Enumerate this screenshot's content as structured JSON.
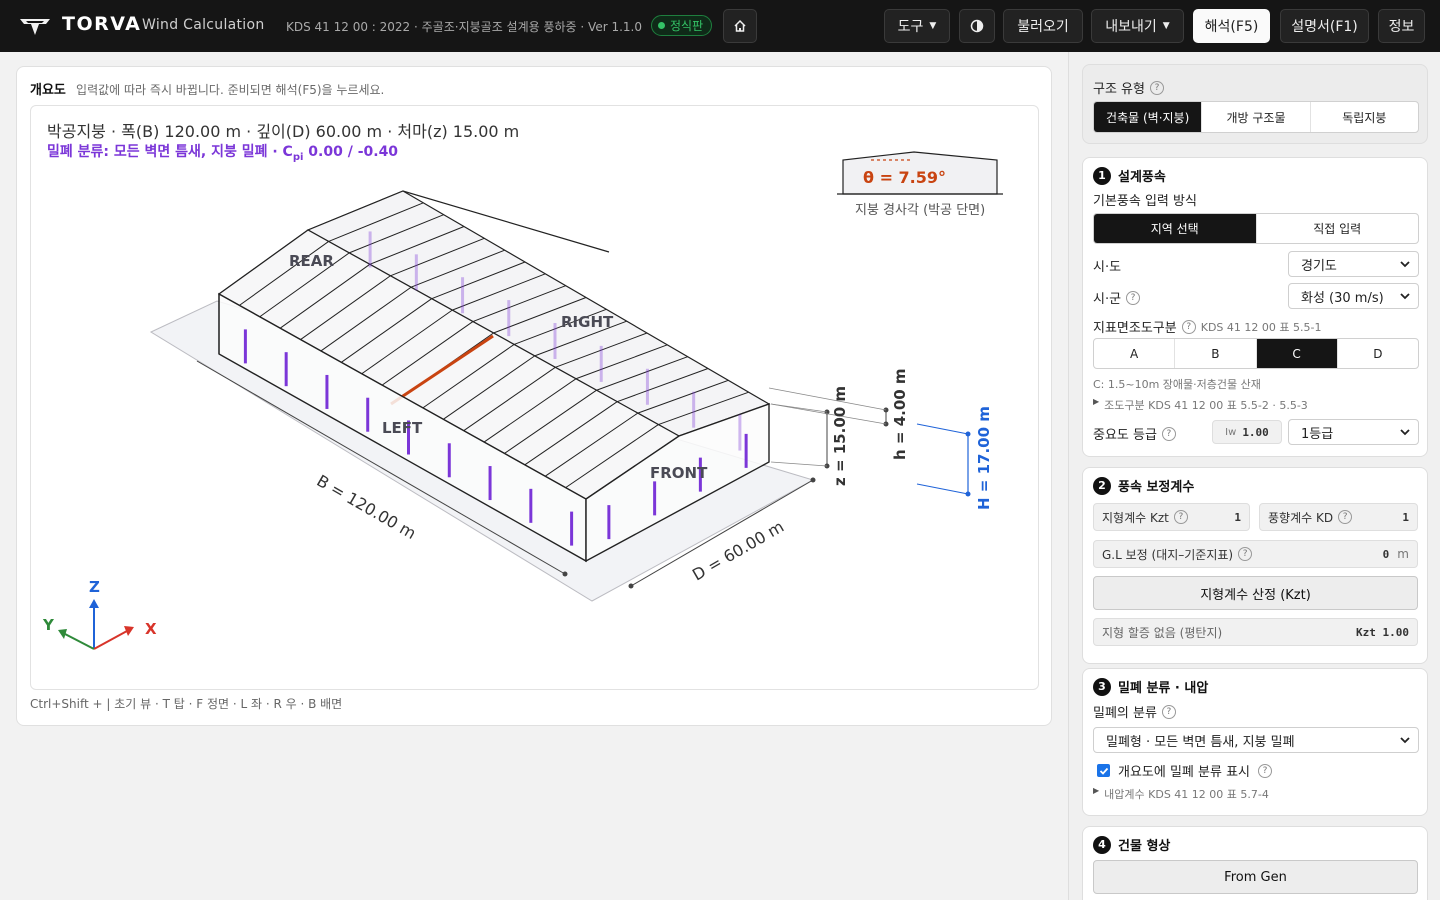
{
  "app": {
    "brand": "TORVA",
    "subtitle": "Wind Calculation",
    "standard": "KDS 41 12 00 : 2022 · 주골조·지붕골조 설계용 풍하중 · Ver 1.1.0",
    "badge": "정식판"
  },
  "toolbar": {
    "tools_label": "도구",
    "load_label": "불러오기",
    "export_label": "내보내기",
    "analyze_label": "해석(F5)",
    "report_label": "설명서(F1)",
    "info_label": "정보"
  },
  "overview": {
    "heading": "개요도",
    "hint": "입력값에 따라 즉시 바뀝니다. 준비되면 해석(F5)을 누르세요.",
    "title": "박공지붕 · 폭(B) 120.00 m · 깊이(D) 60.00 m · 처마(z) 15.00 m",
    "enclosure_prefix": "밀폐 분류: 모든 벽면 틈새, 지붕 밀폐 · C",
    "enclosure_sub": "pi",
    "enclosure_value": " 0.00 / -0.40",
    "roof_angle": "θ = 7.59°",
    "roof_angle_caption": "지붕 경사각 (박공 단면)",
    "face_rear": "REAR",
    "face_right": "RIGHT",
    "face_left": "LEFT",
    "face_front": "FRONT",
    "dim_b": "B = 120.00 m",
    "dim_d": "D = 60.00 m",
    "dim_z": "z = 15.00 m",
    "dim_h_small": "h = 4.00 m",
    "dim_h_total": "H = 17.00 m",
    "axis_x": "X",
    "axis_y": "Y",
    "axis_z": "Z",
    "shortcuts": "Ctrl+Shift + | 초기 뷰 · T 탑 · F 정면 · L 좌 · R 우 · B 배면"
  },
  "colors": {
    "accent_purple": "#7b36d8",
    "ridge_orange": "#c94411",
    "axis_blue": "#1f63d8",
    "axis_red": "#d8342a",
    "axis_green": "#2f8a3a"
  },
  "structure": {
    "label": "구조 유형",
    "options": [
      "건축물 (벽·지붕)",
      "개방 구조물",
      "독립지붕"
    ],
    "selected": "건축물 (벽·지붕)"
  },
  "design_wind": {
    "number": "1",
    "title": "설계풍속",
    "method_label": "기본풍속 입력 방식",
    "method_options": [
      "지역 선택",
      "직접 입력"
    ],
    "method_selected": "지역 선택",
    "province_label": "시·도",
    "province_value": "경기도",
    "city_label": "시·군",
    "city_value": "화성 (30 m/s)",
    "terrain_label": "지표면조도구분",
    "terrain_ref": "KDS 41 12 00 표 5.5-1",
    "terrain_options": [
      "A",
      "B",
      "C",
      "D"
    ],
    "terrain_selected": "C",
    "terrain_note": "C: 1.5~10m 장애물·저층건물 산재",
    "roughness_link": "조도구분 KDS 41 12 00 표 5.5-2 · 5.5-3",
    "importance_label": "중요도 등급",
    "iw_label": "Iw",
    "iw_value": "1.00",
    "importance_value": "1등급"
  },
  "correction": {
    "number": "2",
    "title": "풍속 보정계수",
    "kzt_label": "지형계수 Kzt",
    "kzt_value": "1",
    "kd_label": "풍향계수 KD",
    "kd_value": "1",
    "gl_label": "G.L 보정 (대지–기준지표)",
    "gl_value": "0",
    "gl_unit": "m",
    "kzt_button": "지형계수 산정 (Kzt)",
    "kzt_result_label": "지형 할증 없음 (평탄지)",
    "kzt_result_value": "Kzt  1.00"
  },
  "enclosure": {
    "number": "3",
    "title": "밀폐 분류 · 내압",
    "class_label": "밀폐의 분류",
    "class_value": "밀폐형 · 모든 벽면 틈새, 지붕 밀폐",
    "show_label": "개요도에 밀폐 분류 표시",
    "show_checked": true,
    "internal_link": "내압계수 KDS 41 12 00 표 5.7-4"
  },
  "shape": {
    "number": "4",
    "title": "건물 형상",
    "from_gen": "From Gen"
  }
}
